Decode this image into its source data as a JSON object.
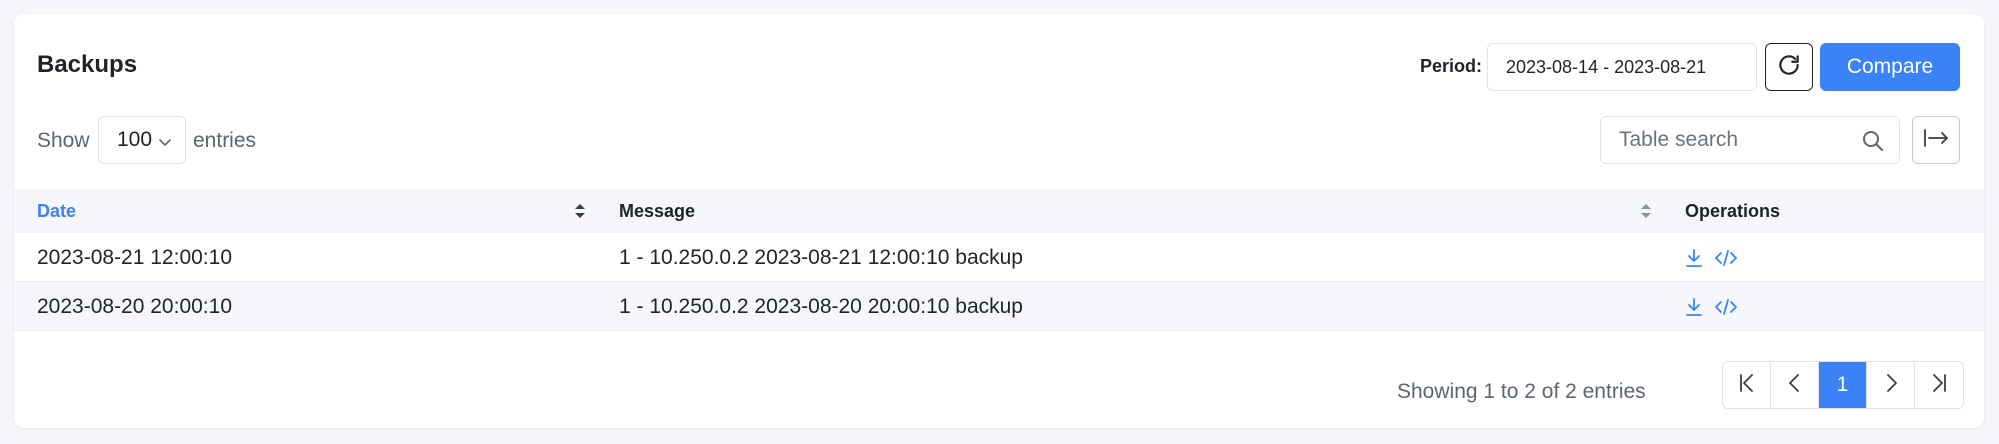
{
  "header": {
    "title": "Backups",
    "period_label": "Period:",
    "period_value": "2023-08-14 - 2023-08-21",
    "compare_label": "Compare"
  },
  "controls": {
    "show_label": "Show",
    "entries_value": "100",
    "entries_label": "entries",
    "search_placeholder": "Table search"
  },
  "table": {
    "columns": [
      {
        "label": "Date",
        "sortable": true,
        "active": true
      },
      {
        "label": "Message",
        "sortable": true
      },
      {
        "label": "Operations",
        "sortable": false
      }
    ],
    "rows": [
      {
        "date": "2023-08-21 12:00:10",
        "message": "1 - 10.250.0.2 2023-08-21 12:00:10 backup",
        "ops": [
          "download-icon",
          "code-icon"
        ]
      },
      {
        "date": "2023-08-20 20:00:10",
        "message": "1 - 10.250.0.2 2023-08-20 20:00:10 backup",
        "ops": [
          "download-icon",
          "code-icon"
        ]
      }
    ]
  },
  "footer": {
    "info": "Showing 1 to 2 of 2 entries",
    "current_page": "1"
  },
  "colors": {
    "accent": "#3b82f6",
    "text": "#1f2329",
    "muted": "#5d6570"
  }
}
